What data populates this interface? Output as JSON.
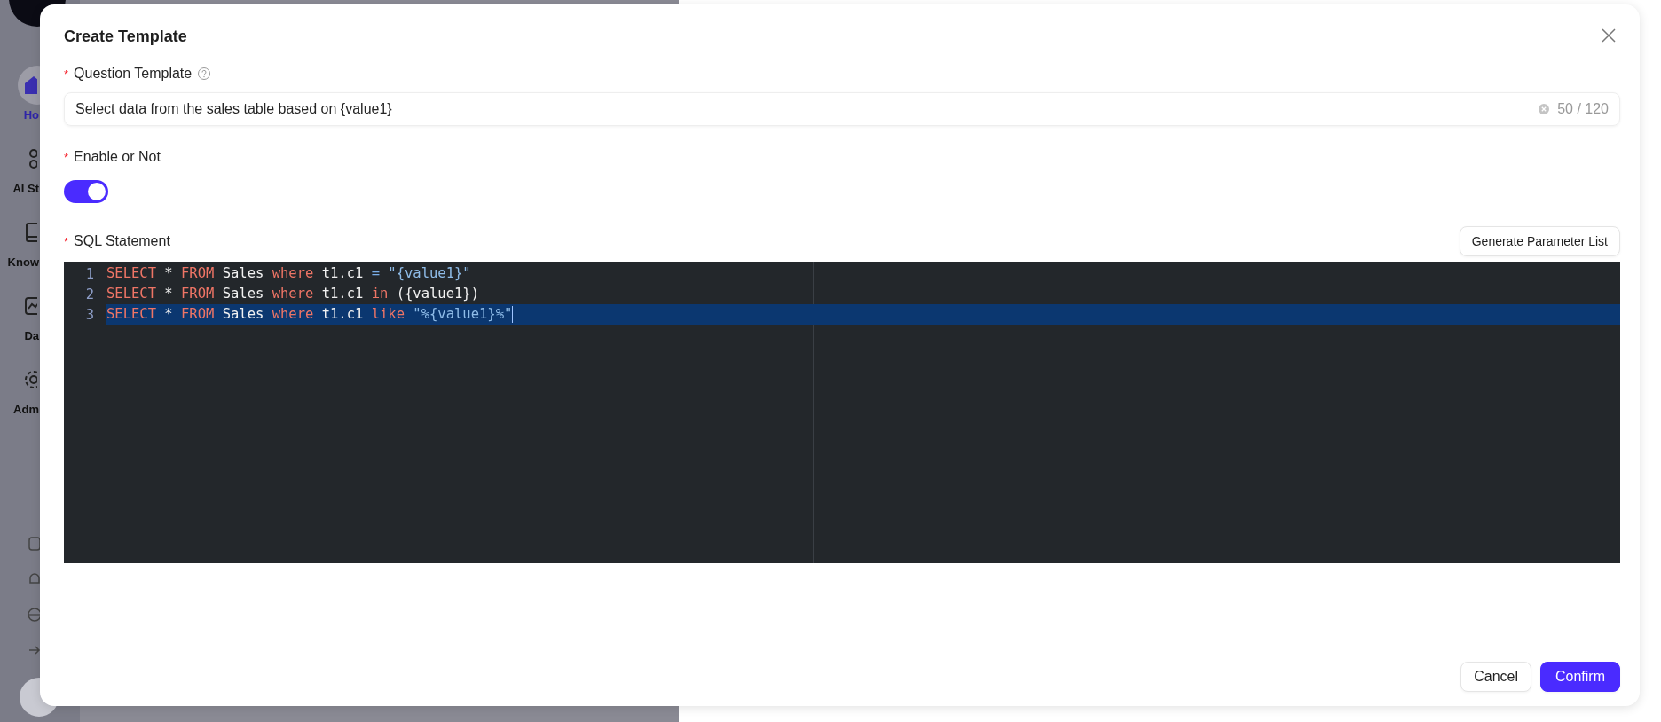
{
  "sidebar": {
    "items": [
      {
        "label": "Ho",
        "selected": true
      },
      {
        "label": "AI St",
        "selected": false
      },
      {
        "label": "Know",
        "selected": false
      },
      {
        "label": "Da",
        "selected": false
      },
      {
        "label": "Adm",
        "selected": false
      }
    ]
  },
  "modal": {
    "title": "Create Template",
    "question": {
      "label": "Question Template",
      "required": true,
      "value": "Select data from the sales table based on {value1}",
      "counter": "50 / 120"
    },
    "enable": {
      "label": "Enable or Not",
      "required": true,
      "on": true
    },
    "sql": {
      "label": "SQL Statement",
      "required": true,
      "button": "Generate Parameter List",
      "lines": [
        {
          "number": "1",
          "active": false,
          "tokens": [
            {
              "kind": "keyword",
              "text": "SELECT"
            },
            {
              "kind": "plain",
              "text": " * "
            },
            {
              "kind": "keyword",
              "text": "FROM"
            },
            {
              "kind": "plain",
              "text": " Sales "
            },
            {
              "kind": "keyword",
              "text": "where"
            },
            {
              "kind": "plain",
              "text": " t1.c1 "
            },
            {
              "kind": "operator",
              "text": "="
            },
            {
              "kind": "string",
              "text": " \"{value1}\""
            }
          ]
        },
        {
          "number": "2",
          "active": false,
          "tokens": [
            {
              "kind": "keyword",
              "text": "SELECT"
            },
            {
              "kind": "plain",
              "text": " * "
            },
            {
              "kind": "keyword",
              "text": "FROM"
            },
            {
              "kind": "plain",
              "text": " Sales "
            },
            {
              "kind": "keyword",
              "text": "where"
            },
            {
              "kind": "plain",
              "text": " t1.c1 "
            },
            {
              "kind": "keyword",
              "text": "in"
            },
            {
              "kind": "plain",
              "text": " ({value1})"
            }
          ]
        },
        {
          "number": "3",
          "active": true,
          "tokens": [
            {
              "kind": "keyword",
              "text": "SELECT"
            },
            {
              "kind": "plain",
              "text": " * "
            },
            {
              "kind": "keyword",
              "text": "FROM"
            },
            {
              "kind": "plain",
              "text": " Sales "
            },
            {
              "kind": "keyword",
              "text": "where"
            },
            {
              "kind": "plain",
              "text": " t1.c1 "
            },
            {
              "kind": "keyword",
              "text": "like"
            },
            {
              "kind": "string",
              "text": " \"%{value1}%\""
            }
          ]
        }
      ]
    },
    "buttons": [
      {
        "label": "Cancel",
        "kind": "default"
      },
      {
        "label": "Confirm",
        "kind": "primary"
      }
    ]
  }
}
